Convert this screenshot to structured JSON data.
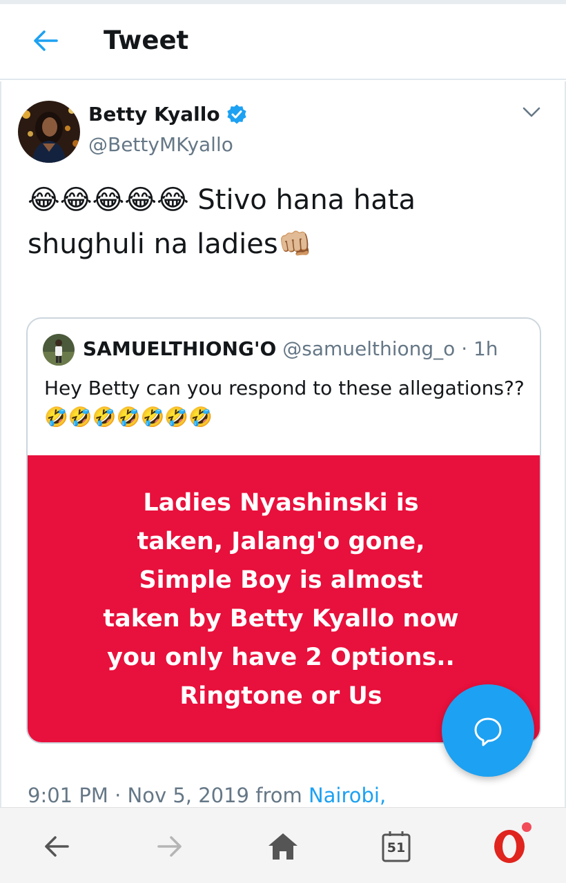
{
  "header": {
    "title": "Tweet"
  },
  "tweet": {
    "author_name": "Betty Kyallo",
    "author_handle": "@BettyMKyallo",
    "text": "😂😂😂😂😂 Stivo hana hata shughuli na ladies👊🏼",
    "timestamp": "9:01 PM · Nov 5, 2019 from",
    "location_link": "Nairobi,"
  },
  "quote": {
    "name": "SAMUELTHIONG'O",
    "handle_time": "@samuelthiong_o · 1h",
    "text": "Hey Betty can you respond to these allegations?? 🤣🤣🤣🤣🤣🤣🤣",
    "image_text": "Ladies Nyashinski is\ntaken, Jalang'o gone,\nSimple Boy is almost\ntaken by Betty Kyallo now\nyou only have 2 Options..\nRingtone or Us"
  },
  "bottom_nav": {
    "tab_count": "51"
  },
  "icons": {
    "back": "back-arrow-icon",
    "verified": "verified-badge-icon",
    "caret": "chevron-down-icon",
    "compose": "compose-reply-icon",
    "browser_back": "browser-back-icon",
    "browser_forward": "browser-forward-icon",
    "home": "home-icon",
    "tabs": "tabs-icon",
    "opera": "opera-logo-icon"
  },
  "colors": {
    "accent": "#1da1f2",
    "quote_image_bg": "#e8103c",
    "secondary_text": "#657786"
  }
}
